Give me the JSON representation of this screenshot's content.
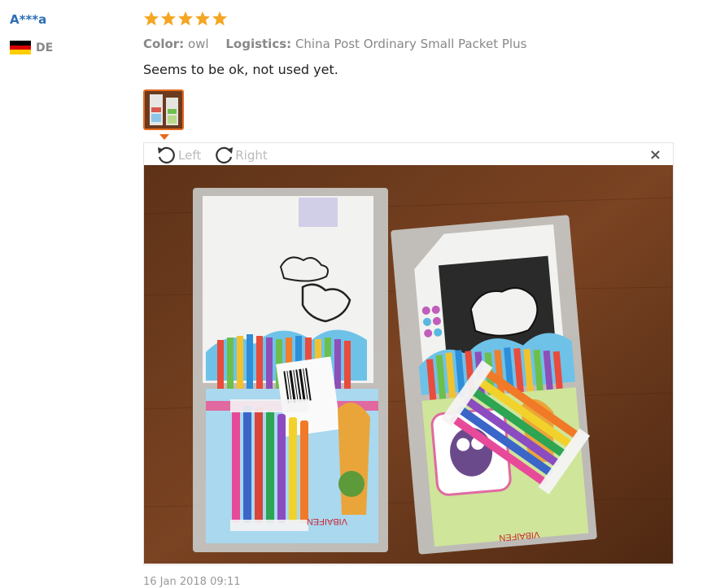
{
  "reviewer": {
    "name": "A***a",
    "country": "DE"
  },
  "review": {
    "rating": 5,
    "color_label": "Color:",
    "color_value": "owl",
    "logistics_label": "Logistics:",
    "logistics_value": "China Post Ordinary Small Packet Plus",
    "text": "Seems to be ok, not used yet.",
    "date": "16 Jan 2018 09:11"
  },
  "viewer": {
    "rotate_left_label": "Left",
    "rotate_right_label": "Right",
    "close_label": "×"
  },
  "colors": {
    "accent": "#e56a1e",
    "star": "#f5a623",
    "link": "#2d6fb5"
  }
}
